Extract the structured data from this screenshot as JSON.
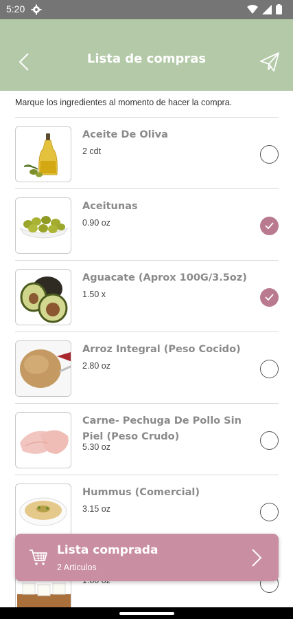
{
  "status_bar": {
    "time": "5:20"
  },
  "app_bar": {
    "title": "Lista de compras"
  },
  "instruction": "Marque los ingredientes al momento de hacer la compra.",
  "items": [
    {
      "name": "Aceite De Oliva",
      "qty": "2 cdt",
      "checked": false,
      "image": "olive-oil"
    },
    {
      "name": "Aceitunas",
      "qty": "0.90 oz",
      "checked": true,
      "image": "olives"
    },
    {
      "name": "Aguacate (Aprox 100G/3.5oz)",
      "qty": "1.50 x",
      "checked": true,
      "image": "avocado"
    },
    {
      "name": "Arroz Integral (Peso Cocido)",
      "qty": "2.80 oz",
      "checked": false,
      "image": "brown-rice"
    },
    {
      "name": "Carne- Pechuga De Pollo Sin Piel (Peso Crudo)",
      "qty": "5.30 oz",
      "checked": false,
      "image": "chicken-breast"
    },
    {
      "name": "Hummus (Comercial)",
      "qty": "3.15 oz",
      "checked": false,
      "image": "hummus"
    },
    {
      "name": "",
      "qty": "1.80 oz",
      "checked": false,
      "image": "tofu"
    }
  ],
  "summary_card": {
    "title": "Lista comprada",
    "subtitle": "2 Articulos"
  },
  "colors": {
    "header": "#b3c9a7",
    "accent": "#b97a8f",
    "card": "#c98ea1"
  }
}
